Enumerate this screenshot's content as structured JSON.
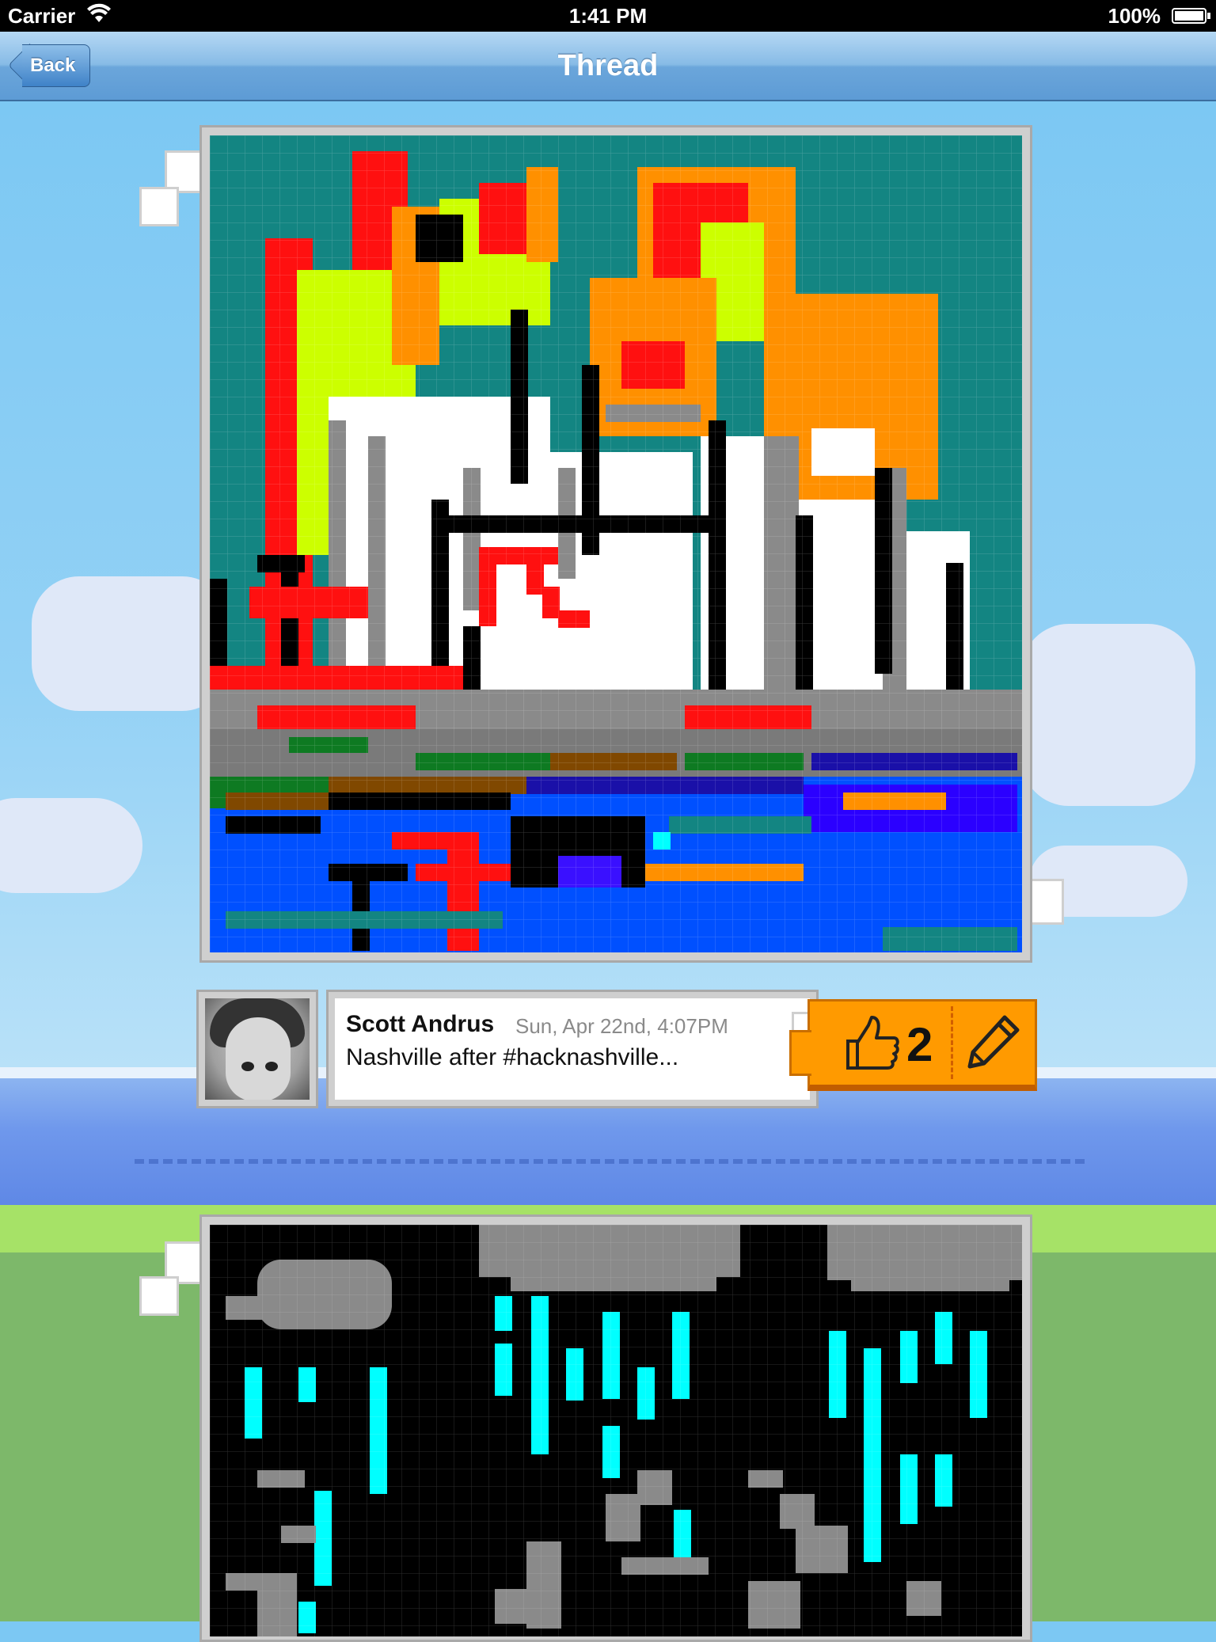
{
  "status_bar": {
    "carrier": "Carrier",
    "time": "1:41 PM",
    "battery": "100%"
  },
  "nav_bar": {
    "title": "Thread",
    "back_label": "Back"
  },
  "post": {
    "author": "Scott Andrus",
    "timestamp": "Sun, Apr 22nd, 4:07PM",
    "caption": "Nashville after #hacknashville...",
    "like_count": "2",
    "like_icon": "thumbs-up-icon",
    "edit_icon": "pencil-icon"
  },
  "colors": {
    "nav_accent": "#5d9bd5",
    "action_orange": "#ff9a00",
    "frame_gray": "#cfcfcf"
  }
}
